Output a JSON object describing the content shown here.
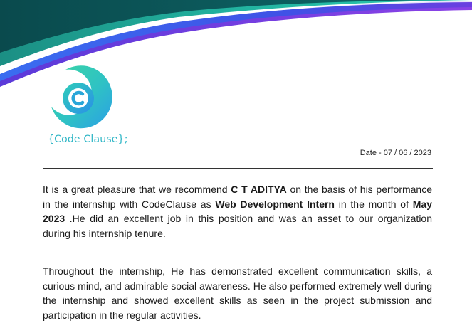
{
  "header": {
    "brand_text": "{Code Clause};",
    "date": "Date - 07 / 06 / 2023"
  },
  "letter": {
    "p1": {
      "t1": "It is a great pleasure that we recommend ",
      "name": "C T ADITYA",
      "t2": " on the basis of his performance in the internship with CodeClause as ",
      "role": "Web Development Intern",
      "t3": " in the month of ",
      "month": "May 2023",
      "t4": " .He did an excellent job in this position and was an asset to our organization during his internship tenure."
    },
    "p2": "Throughout the internship, He has demonstrated excellent communication skills, a curious mind, and admirable social awareness. He also performed extremely well during the internship and showed excellent skills as seen in the project submission and participation in the regular activities."
  },
  "colors": {
    "banner_dark": "#0b4f52",
    "banner_teal": "#1fa99a",
    "banner_blue": "#2f5be8",
    "banner_purple": "#7b3fe0",
    "logo_gradient_start": "#36d1a8",
    "logo_gradient_end": "#2b9fe6",
    "brand_text": "#2fb6c6"
  }
}
